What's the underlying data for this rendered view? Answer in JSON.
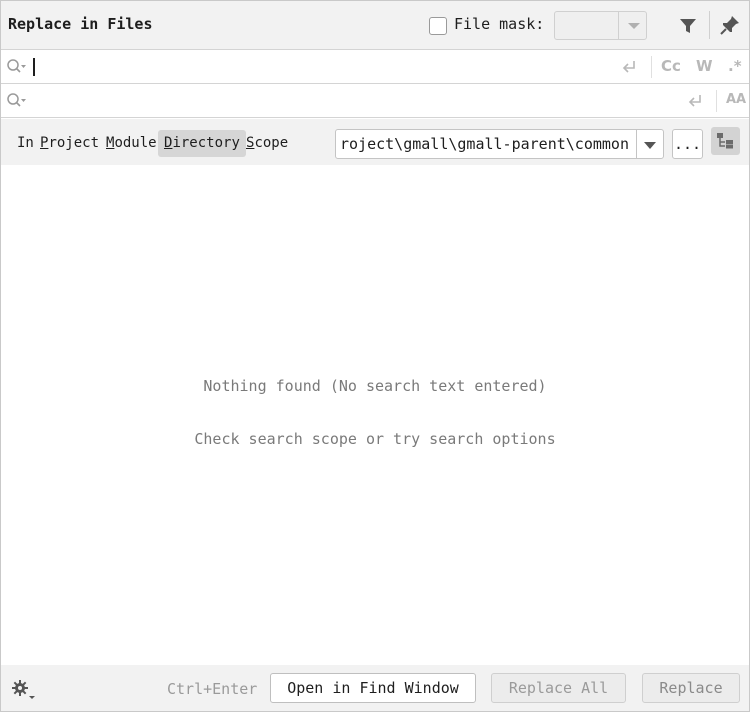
{
  "header": {
    "title": "Replace in Files",
    "file_mask_label": "File mask:",
    "file_mask_checked": false,
    "file_mask_value": "",
    "icons": {
      "filter": "filter-icon",
      "pin": "pin-icon"
    }
  },
  "search": {
    "find_value": "",
    "replace_value": "",
    "options": {
      "match_case": "Cc",
      "words": "W",
      "regex": ".*",
      "preserve_case": "AA"
    }
  },
  "scope": {
    "tabs": [
      {
        "pre": "In ",
        "mnemonic": "",
        "rest": "",
        "active": false
      },
      {
        "pre": "",
        "mnemonic": "P",
        "rest": "roject",
        "active": false
      },
      {
        "pre": "",
        "mnemonic": "M",
        "rest": "odule",
        "active": false
      },
      {
        "pre": "",
        "mnemonic": "D",
        "rest": "irectory",
        "active": true
      },
      {
        "pre": "",
        "mnemonic": "S",
        "rest": "cope",
        "active": false
      }
    ],
    "directory_value": "roject\\gmall\\gmall-parent\\common",
    "browse_label": "...",
    "recursive_icon": "tree-structure-icon"
  },
  "results": {
    "message": "Nothing found (No search text entered)",
    "hint": "Check search scope or try search options"
  },
  "footer": {
    "settings_icon": "gear-icon",
    "shortcut": "Ctrl+Enter",
    "open_in_find_window": "Open in Find Window",
    "replace_all": "Replace All",
    "replace": "Replace"
  },
  "colors": {
    "panel_bg": "#f2f2f2",
    "border": "#d4d4d4",
    "active_scope": "#d6d6d6",
    "muted_text": "#7a7a7a"
  }
}
